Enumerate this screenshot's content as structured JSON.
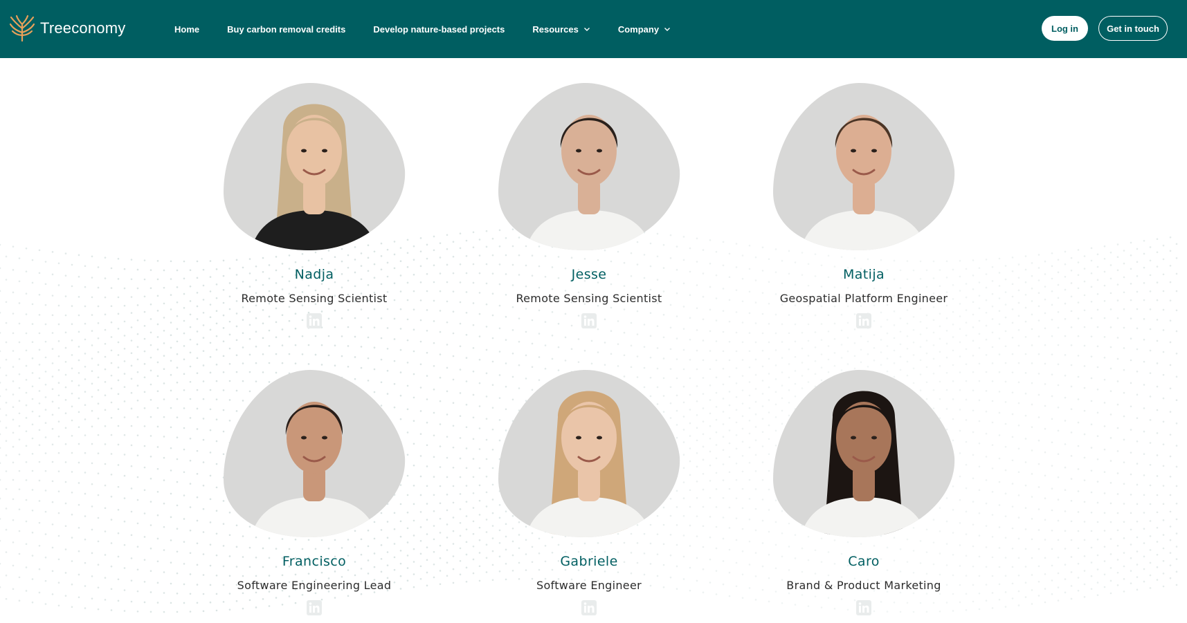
{
  "brand": {
    "name": "Treeconomy",
    "accent": "#e8a15a",
    "primary": "#005e61"
  },
  "nav": {
    "items": [
      {
        "label": "Home",
        "has_dropdown": false
      },
      {
        "label": "Buy carbon removal credits",
        "has_dropdown": false
      },
      {
        "label": "Develop nature-based projects",
        "has_dropdown": false
      },
      {
        "label": "Resources",
        "has_dropdown": true
      },
      {
        "label": "Company",
        "has_dropdown": true
      }
    ],
    "login_label": "Log in",
    "contact_label": "Get in touch"
  },
  "team": [
    {
      "name": "Nadja",
      "role": "Remote Sensing Scientist",
      "icon": "linkedin-icon",
      "hair": "#c9b08a",
      "shirt": "#1e1e1e",
      "skin": "#e8c2a3"
    },
    {
      "name": "Jesse",
      "role": "Remote Sensing Scientist",
      "icon": "linkedin-icon",
      "hair": "#2a211c",
      "shirt": "#f3f3f1",
      "skin": "#d9b096"
    },
    {
      "name": "Matija",
      "role": "Geospatial Platform Engineer",
      "icon": "linkedin-icon",
      "hair": "#4b3526",
      "shirt": "#f3f3f1",
      "skin": "#dcae92"
    },
    {
      "name": "Francisco",
      "role": "Software Engineering Lead",
      "icon": "linkedin-icon",
      "hair": "#2a1f1a",
      "shirt": "#f3f3f1",
      "skin": "#c99779"
    },
    {
      "name": "Gabriele",
      "role": "Software Engineer",
      "icon": "linkedin-icon",
      "hair": "#cfa779",
      "shirt": "#f3f3f1",
      "skin": "#eac5a9"
    },
    {
      "name": "Caro",
      "role": "Brand & Product Marketing",
      "icon": "linkedin-icon",
      "hair": "#1c1512",
      "shirt": "#f3f3f1",
      "skin": "#a8765a"
    }
  ]
}
